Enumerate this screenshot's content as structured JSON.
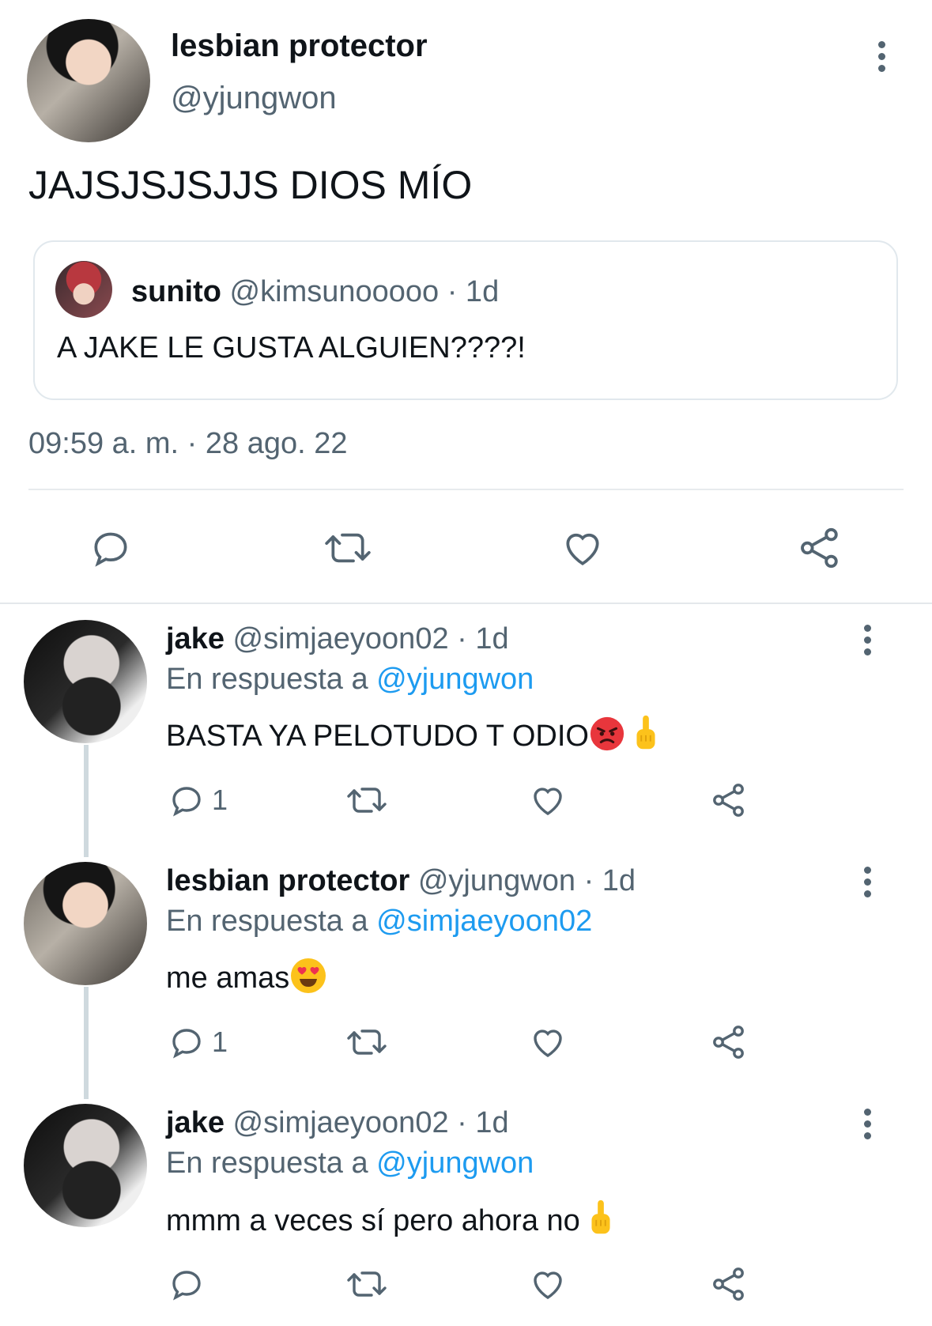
{
  "main_tweet": {
    "author_name": "lesbian protector",
    "author_handle": "@yjungwon",
    "text": "JAJSJSJSJJS DIOS MÍO",
    "quoted": {
      "author_name": "sunito",
      "author_handle": "@kimsunooooo",
      "age": "· 1d",
      "text": "A JAKE LE GUSTA ALGUIEN????!"
    },
    "timestamp": "09:59 a. m. · 28 ago. 22"
  },
  "icons": {
    "reply": "reply-icon",
    "retweet": "retweet-icon",
    "like": "heart-icon",
    "share": "share-icon",
    "more": "more-vertical-icon"
  },
  "colors": {
    "link": "#1d9bf0",
    "muted": "#536471",
    "text": "#0f1419"
  },
  "replies": [
    {
      "author_name": "jake",
      "author_handle": "@simjaeyoon02",
      "age": "· 1d",
      "reply_prefix": "En respuesta a",
      "reply_to": "@yjungwon",
      "text": "BASTA YA PELOTUDO T ODIO",
      "emojis": [
        "angry-face",
        "middle-finger"
      ],
      "reply_count": "1"
    },
    {
      "author_name": "lesbian protector",
      "author_handle": "@yjungwon",
      "age": "· 1d",
      "reply_prefix": "En respuesta a",
      "reply_to": "@simjaeyoon02",
      "text": "me amas",
      "emojis": [
        "heart-eyes-face"
      ],
      "reply_count": "1"
    },
    {
      "author_name": "jake",
      "author_handle": "@simjaeyoon02",
      "age": "· 1d",
      "reply_prefix": "En respuesta a",
      "reply_to": "@yjungwon",
      "text": "mmm a veces sí pero ahora no",
      "emojis": [
        "middle-finger"
      ],
      "reply_count": ""
    }
  ]
}
